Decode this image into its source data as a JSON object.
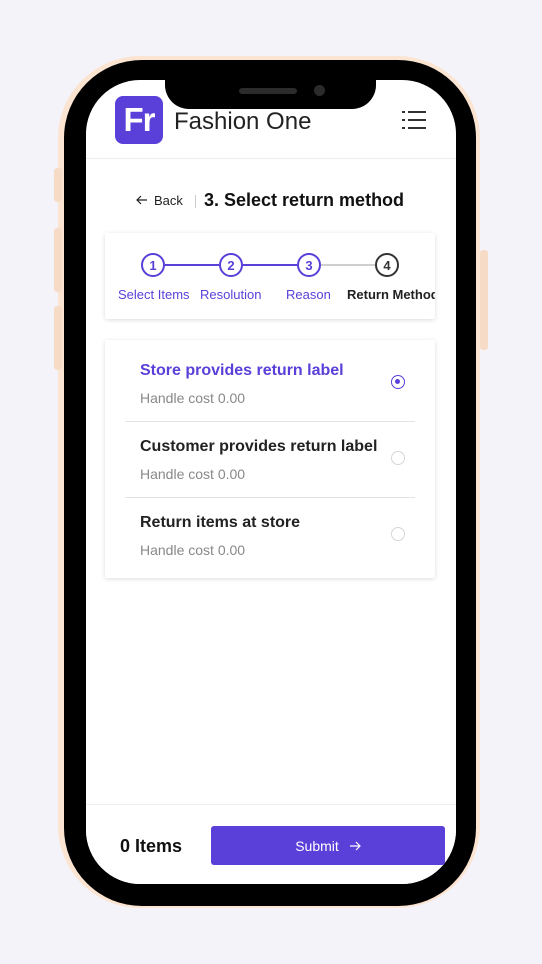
{
  "header": {
    "logo_text": "Fr",
    "brand_name": "Fashion One",
    "menu_icon": "hamburger-menu-icon"
  },
  "titlebar": {
    "back_label": "Back",
    "back_icon": "arrow-left-icon",
    "title": "3. Select return method"
  },
  "steps": [
    {
      "number": "1",
      "label": "Select Items",
      "state": "done"
    },
    {
      "number": "2",
      "label": "Resolution",
      "state": "done"
    },
    {
      "number": "3",
      "label": "Reason",
      "state": "current"
    },
    {
      "number": "4",
      "label": "Return Method",
      "state": "upcoming"
    }
  ],
  "options": [
    {
      "title": "Store provides return label",
      "subtitle": "Handle cost 0.00",
      "selected": true
    },
    {
      "title": "Customer provides return label",
      "subtitle": "Handle cost 0.00",
      "selected": false
    },
    {
      "title": "Return items at store",
      "subtitle": "Handle cost 0.00",
      "selected": false
    }
  ],
  "footer": {
    "items_count": "0 Items",
    "submit_label": "Submit",
    "submit_icon": "arrow-right-icon"
  },
  "colors": {
    "accent": "#5a3fd9",
    "text": "#222222",
    "muted": "#888888",
    "upcoming": "#333333"
  }
}
